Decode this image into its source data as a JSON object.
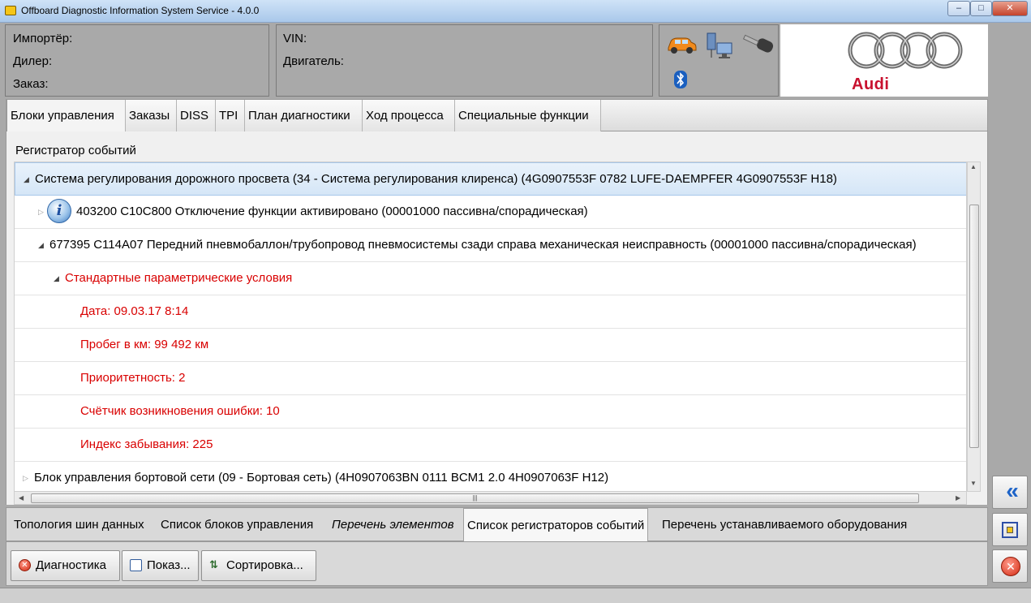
{
  "window": {
    "title": "Offboard Diagnostic Information System Service - 4.0.0",
    "min_glyph": "–",
    "max_glyph": "□",
    "close_glyph": "✕"
  },
  "info_left": {
    "importer_label": "Импортёр:",
    "dealer_label": "Дилер:",
    "order_label": "Заказ:"
  },
  "info_right": {
    "vin_label": "VIN:",
    "engine_label": "Двигатель:"
  },
  "logo": {
    "brand": "Audi"
  },
  "top_tabs": [
    "Блоки управления",
    "Заказы",
    "DISS",
    "TPI",
    "План диагностики",
    "Ход процесса",
    "Специальные функции"
  ],
  "section_label": "Регистратор событий",
  "tree": {
    "rows": [
      "Система регулирования дорожного просвета (34 - Система регулирования клиренса) (4G0907553F    0782   LUFE-DAEMPFER   4G0907553F     H18)",
      "403200    C10C800    Отключение функции активировано  (00001000    пассивна/спорадическая)",
      "677395    C114A07    Передний пневмобаллон/трубопровод пневмосистемы сзади справа механическая неисправность  (00001000    пассивна/спорадическая)",
      "Стандартные параметрические условия",
      "Дата: 09.03.17 8:14",
      "Пробег в км: 99 492 км",
      "Приоритетность: 2",
      "Счётчик возникновения ошибки: 10",
      "Индекс забывания: 225",
      "Блок управления бортовой сети (09 - Бортовая сеть) (4H0907063BN    0111    BCM1 2.0        4H0907063F     H12)"
    ],
    "info_glyph": "i",
    "expanded_glyph": "◢",
    "collapsed_glyph": "▷"
  },
  "scroll": {
    "up": "▲",
    "down": "▼",
    "left": "◀",
    "right": "▶",
    "grip": "≡",
    "hgrip": "|||"
  },
  "bottom_tabs": [
    "Топология шин данных",
    "Список блоков управления",
    "Перечень элементов",
    "Список регистраторов событий",
    "Перечень устанавливаемого оборудования"
  ],
  "toolbar": {
    "diagnostics_label": "Диагностика",
    "show_label": "Показ...",
    "sort_label": "Сортировка...",
    "sort_glyph": "⇅",
    "diag_glyph": "✕"
  },
  "side_buttons": {
    "back_glyph": "«",
    "close_glyph": "✕"
  },
  "colors": {
    "accent_red": "#d90000",
    "audi_red": "#c8102e",
    "selection_blue": "#d5e6f7"
  }
}
